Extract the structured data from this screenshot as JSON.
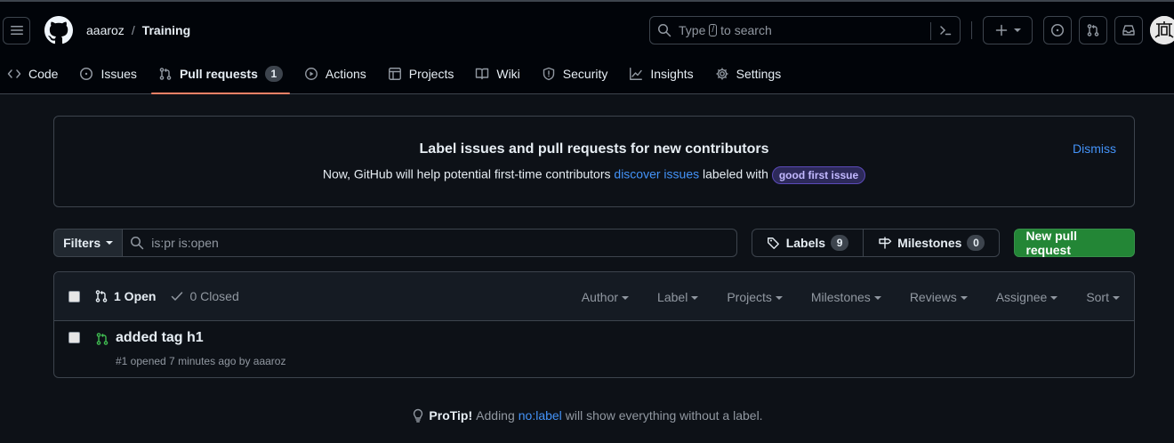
{
  "header": {
    "owner": "aaaroz",
    "separator": "/",
    "repo": "Training",
    "search": {
      "prefix": "Type",
      "key": "/",
      "suffix": "to search"
    }
  },
  "nav": {
    "tabs": [
      {
        "label": "Code",
        "icon": "code-icon"
      },
      {
        "label": "Issues",
        "icon": "issue-icon"
      },
      {
        "label": "Pull requests",
        "icon": "pull-request-icon",
        "count": "1",
        "active": true
      },
      {
        "label": "Actions",
        "icon": "play-icon"
      },
      {
        "label": "Projects",
        "icon": "table-icon"
      },
      {
        "label": "Wiki",
        "icon": "book-icon"
      },
      {
        "label": "Security",
        "icon": "shield-icon"
      },
      {
        "label": "Insights",
        "icon": "graph-icon"
      },
      {
        "label": "Settings",
        "icon": "gear-icon"
      }
    ]
  },
  "banner": {
    "title": "Label issues and pull requests for new contributors",
    "text_before": "Now, GitHub will help potential first-time contributors",
    "link": "discover issues",
    "text_after": "labeled with",
    "label": "good first issue",
    "dismiss": "Dismiss"
  },
  "filters": {
    "button": "Filters",
    "query": "is:pr is:open",
    "labels_label": "Labels",
    "labels_count": "9",
    "milestones_label": "Milestones",
    "milestones_count": "0",
    "new_pr": "New pull request"
  },
  "list": {
    "open": "1 Open",
    "closed": "0 Closed",
    "sorts": [
      "Author",
      "Label",
      "Projects",
      "Milestones",
      "Reviews",
      "Assignee",
      "Sort"
    ],
    "items": [
      {
        "title": "added tag h1",
        "meta": "#1 opened 7 minutes ago by aaaroz"
      }
    ]
  },
  "protip": {
    "lead": "ProTip!",
    "before": "Adding",
    "link": "no:label",
    "after": "will show everything without a label."
  },
  "colors": {
    "background": "#0d1117",
    "header": "#010409",
    "border": "#3d444d",
    "accent_link": "#4493f8",
    "primary_button": "#238636",
    "active_tab_underline": "#f78166",
    "open_state": "#3fb950"
  }
}
